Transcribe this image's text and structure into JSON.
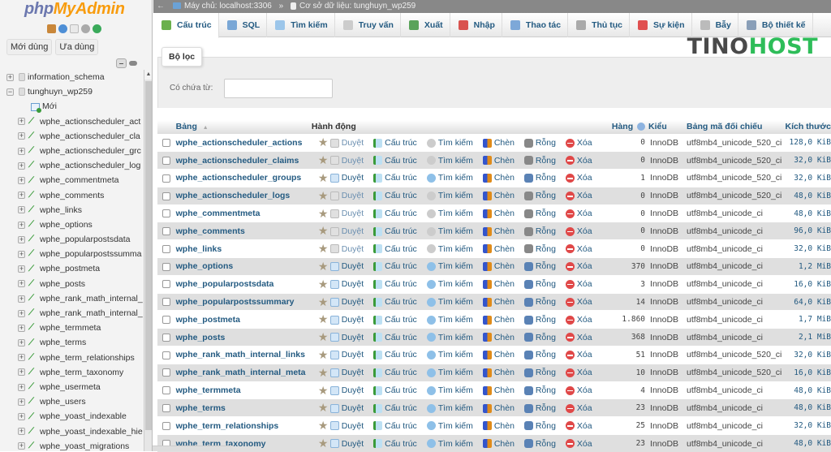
{
  "app": {
    "logo_php": "php",
    "logo_rest": "MyAdmin",
    "nav_icons": [
      "home-icon",
      "help-icon",
      "docs-icon",
      "settings-icon",
      "reload-icon"
    ],
    "recent_button": "Mới dùng",
    "favorites_button": "Ưa dùng"
  },
  "breadcrumb": {
    "server": "Máy chủ: localhost:3306",
    "separator": "»",
    "database": "Cơ sở dữ liệu: tunghuyn_wp259"
  },
  "tabs": [
    {
      "label": "Cấu trúc",
      "icon": "structure-icon",
      "active": true,
      "color": "#6ab04c"
    },
    {
      "label": "SQL",
      "icon": "sql-icon",
      "color": "#7aa7d6"
    },
    {
      "label": "Tìm kiếm",
      "icon": "search-icon",
      "color": "#9cc6ea"
    },
    {
      "label": "Truy vấn",
      "icon": "query-icon",
      "color": "#cccccc"
    },
    {
      "label": "Xuất",
      "icon": "export-icon",
      "color": "#5aa35a"
    },
    {
      "label": "Nhập",
      "icon": "import-icon",
      "color": "#d9534f"
    },
    {
      "label": "Thao tác",
      "icon": "operations-icon",
      "color": "#7da8d8"
    },
    {
      "label": "Thủ tục",
      "icon": "routines-icon",
      "color": "#aaaaaa"
    },
    {
      "label": "Sự kiện",
      "icon": "events-icon",
      "color": "#e05050"
    },
    {
      "label": "Bẫy",
      "icon": "triggers-icon",
      "color": "#bbbbbb"
    },
    {
      "label": "Bộ thiết kế",
      "icon": "designer-icon",
      "color": "#8a9fb8"
    }
  ],
  "brand": {
    "part1": "TINO",
    "part2": "HOST"
  },
  "filter": {
    "tab_label": "Bộ lọc",
    "contains_label": "Có chứa từ:",
    "input_value": ""
  },
  "navigation_tree": {
    "databases": [
      {
        "name": "information_schema",
        "expanded": false
      },
      {
        "name": "tunghuyn_wp259",
        "expanded": true
      }
    ],
    "new_label": "Mới",
    "tables": [
      "wphe_actionscheduler_act",
      "wphe_actionscheduler_cla",
      "wphe_actionscheduler_grc",
      "wphe_actionscheduler_log",
      "wphe_commentmeta",
      "wphe_comments",
      "wphe_links",
      "wphe_options",
      "wphe_popularpostsdata",
      "wphe_popularpostssumma",
      "wphe_postmeta",
      "wphe_posts",
      "wphe_rank_math_internal_",
      "wphe_rank_math_internal_",
      "wphe_termmeta",
      "wphe_terms",
      "wphe_term_relationships",
      "wphe_term_taxonomy",
      "wphe_usermeta",
      "wphe_users",
      "wphe_yoast_indexable",
      "wphe_yoast_indexable_hie",
      "wphe_yoast_migrations"
    ]
  },
  "table": {
    "headers": {
      "table": "Bảng",
      "sort_indicator": "▲",
      "action": "Hành động",
      "rows": "Hàng",
      "type": "Kiểu",
      "collation": "Bảng mã đối chiếu",
      "size": "Kích thước"
    },
    "actions": {
      "browse": "Duyệt",
      "structure": "Cấu trúc",
      "search": "Tìm kiếm",
      "insert": "Chèn",
      "empty": "Rỗng",
      "drop": "Xóa"
    },
    "rows": [
      {
        "name": "wphe_actionscheduler_actions",
        "rows": "0",
        "type": "InnoDB",
        "collation": "utf8mb4_unicode_520_ci",
        "size": "128,0 KiB"
      },
      {
        "name": "wphe_actionscheduler_claims",
        "rows": "0",
        "type": "InnoDB",
        "collation": "utf8mb4_unicode_520_ci",
        "size": "32,0 KiB"
      },
      {
        "name": "wphe_actionscheduler_groups",
        "rows": "1",
        "type": "InnoDB",
        "collation": "utf8mb4_unicode_520_ci",
        "size": "32,0 KiB"
      },
      {
        "name": "wphe_actionscheduler_logs",
        "rows": "0",
        "type": "InnoDB",
        "collation": "utf8mb4_unicode_520_ci",
        "size": "48,0 KiB"
      },
      {
        "name": "wphe_commentmeta",
        "rows": "0",
        "type": "InnoDB",
        "collation": "utf8mb4_unicode_ci",
        "size": "48,0 KiB"
      },
      {
        "name": "wphe_comments",
        "rows": "0",
        "type": "InnoDB",
        "collation": "utf8mb4_unicode_ci",
        "size": "96,0 KiB"
      },
      {
        "name": "wphe_links",
        "rows": "0",
        "type": "InnoDB",
        "collation": "utf8mb4_unicode_ci",
        "size": "32,0 KiB"
      },
      {
        "name": "wphe_options",
        "rows": "370",
        "type": "InnoDB",
        "collation": "utf8mb4_unicode_ci",
        "size": "1,2 MiB"
      },
      {
        "name": "wphe_popularpostsdata",
        "rows": "3",
        "type": "InnoDB",
        "collation": "utf8mb4_unicode_ci",
        "size": "16,0 KiB"
      },
      {
        "name": "wphe_popularpostssummary",
        "rows": "14",
        "type": "InnoDB",
        "collation": "utf8mb4_unicode_ci",
        "size": "64,0 KiB"
      },
      {
        "name": "wphe_postmeta",
        "rows": "1.860",
        "type": "InnoDB",
        "collation": "utf8mb4_unicode_ci",
        "size": "1,7 MiB"
      },
      {
        "name": "wphe_posts",
        "rows": "368",
        "type": "InnoDB",
        "collation": "utf8mb4_unicode_ci",
        "size": "2,1 MiB"
      },
      {
        "name": "wphe_rank_math_internal_links",
        "rows": "51",
        "type": "InnoDB",
        "collation": "utf8mb4_unicode_520_ci",
        "size": "32,0 KiB"
      },
      {
        "name": "wphe_rank_math_internal_meta",
        "rows": "10",
        "type": "InnoDB",
        "collation": "utf8mb4_unicode_520_ci",
        "size": "16,0 KiB"
      },
      {
        "name": "wphe_termmeta",
        "rows": "4",
        "type": "InnoDB",
        "collation": "utf8mb4_unicode_ci",
        "size": "48,0 KiB"
      },
      {
        "name": "wphe_terms",
        "rows": "23",
        "type": "InnoDB",
        "collation": "utf8mb4_unicode_ci",
        "size": "48,0 KiB"
      },
      {
        "name": "wphe_term_relationships",
        "rows": "25",
        "type": "InnoDB",
        "collation": "utf8mb4_unicode_ci",
        "size": "32,0 KiB"
      },
      {
        "name": "wphe_term_taxonomy",
        "rows": "23",
        "type": "InnoDB",
        "collation": "utf8mb4_unicode_ci",
        "size": "48,0 KiB"
      }
    ]
  }
}
